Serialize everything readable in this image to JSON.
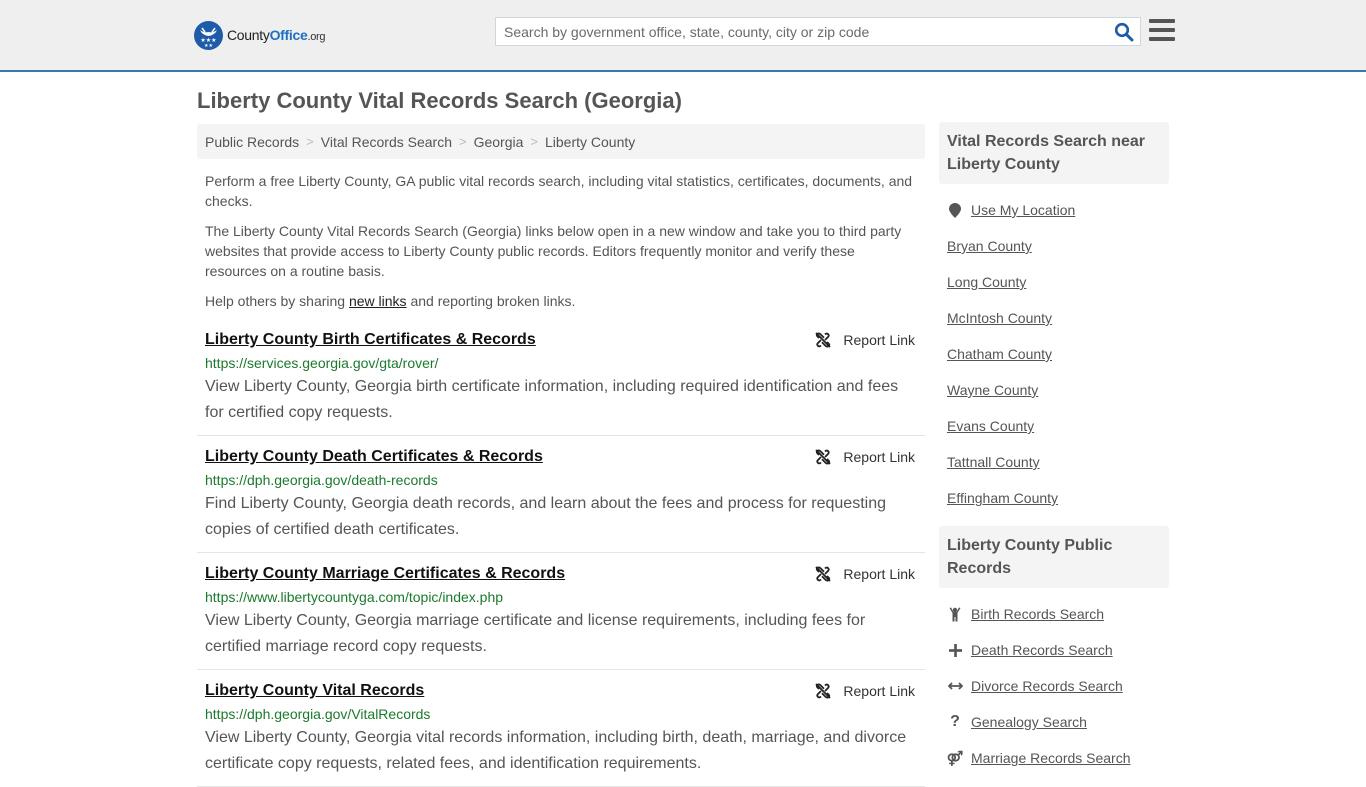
{
  "header": {
    "logo": {
      "name_part1": "County",
      "name_part2": "Office",
      "tld": ".org"
    },
    "search": {
      "placeholder": "Search by government office, state, county, city or zip code",
      "value": ""
    },
    "accent_color": "#3a7aa8"
  },
  "page_title": "Liberty County Vital Records Search (Georgia)",
  "breadcrumb": [
    "Public Records",
    "Vital Records Search",
    "Georgia",
    "Liberty County"
  ],
  "intro": {
    "p1": "Perform a free Liberty County, GA public vital records search, including vital statistics, certificates, documents, and checks.",
    "p2": "The Liberty County Vital Records Search (Georgia) links below open in a new window and take you to third party websites that provide access to Liberty County public records. Editors frequently monitor and verify these resources on a routine basis.",
    "p3_before": "Help others by sharing ",
    "p3_link": "new links",
    "p3_after": " and reporting broken links."
  },
  "report_label": "Report Link",
  "results": [
    {
      "title": "Liberty County Birth Certificates & Records",
      "url": "https://services.georgia.gov/gta/rover/",
      "description": "View Liberty County, Georgia birth certificate information, including required identification and fees for certified copy requests."
    },
    {
      "title": "Liberty County Death Certificates & Records",
      "url": "https://dph.georgia.gov/death-records",
      "description": "Find Liberty County, Georgia death records, and learn about the fees and process for requesting copies of certified death certificates."
    },
    {
      "title": "Liberty County Marriage Certificates & Records",
      "url": "https://www.libertycountyga.com/topic/index.php",
      "description": "View Liberty County, Georgia marriage certificate and license requirements, including fees for certified marriage record copy requests."
    },
    {
      "title": "Liberty County Vital Records",
      "url": "https://dph.georgia.gov/VitalRecords",
      "description": "View Liberty County, Georgia vital records information, including birth, death, marriage, and divorce certificate copy requests, related fees, and identification requirements."
    }
  ],
  "sidebar": {
    "nearby": {
      "heading": "Vital Records Search near Liberty County",
      "use_location": "Use My Location",
      "items": [
        "Bryan County",
        "Long County",
        "McIntosh County",
        "Chatham County",
        "Wayne County",
        "Evans County",
        "Tattnall County",
        "Effingham County"
      ]
    },
    "public_records": {
      "heading": "Liberty County Public Records",
      "items": [
        {
          "label": "Birth Records Search",
          "icon": "child-icon"
        },
        {
          "label": "Death Records Search",
          "icon": "plus-icon"
        },
        {
          "label": "Divorce Records Search",
          "icon": "arrows-h-icon"
        },
        {
          "label": "Genealogy Search",
          "icon": "question-icon"
        },
        {
          "label": "Marriage Records Search",
          "icon": "venus-mars-icon"
        }
      ]
    }
  }
}
